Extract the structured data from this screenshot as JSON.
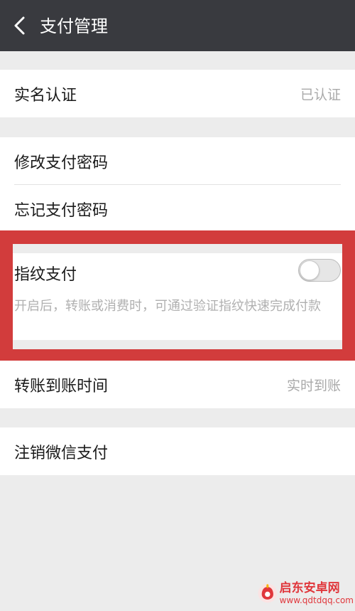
{
  "header": {
    "title": "支付管理",
    "back_icon": "chevron-left-icon"
  },
  "realname": {
    "label": "实名认证",
    "value": "已认证"
  },
  "password": {
    "change_label": "修改支付密码",
    "forgot_label": "忘记支付密码"
  },
  "fingerprint": {
    "label": "指纹支付",
    "enabled": false,
    "description": "开启后，转账或消费时，可通过验证指纹快速完成付款"
  },
  "transfer": {
    "label": "转账到账时间",
    "value": "实时到账"
  },
  "cancel": {
    "label": "注销微信支付"
  },
  "watermark": {
    "name": "启东安卓网",
    "url": "www.qdtdqq.com"
  },
  "colors": {
    "header_bg": "#393a3f",
    "highlight": "#d23c3c",
    "background": "#ececec"
  }
}
